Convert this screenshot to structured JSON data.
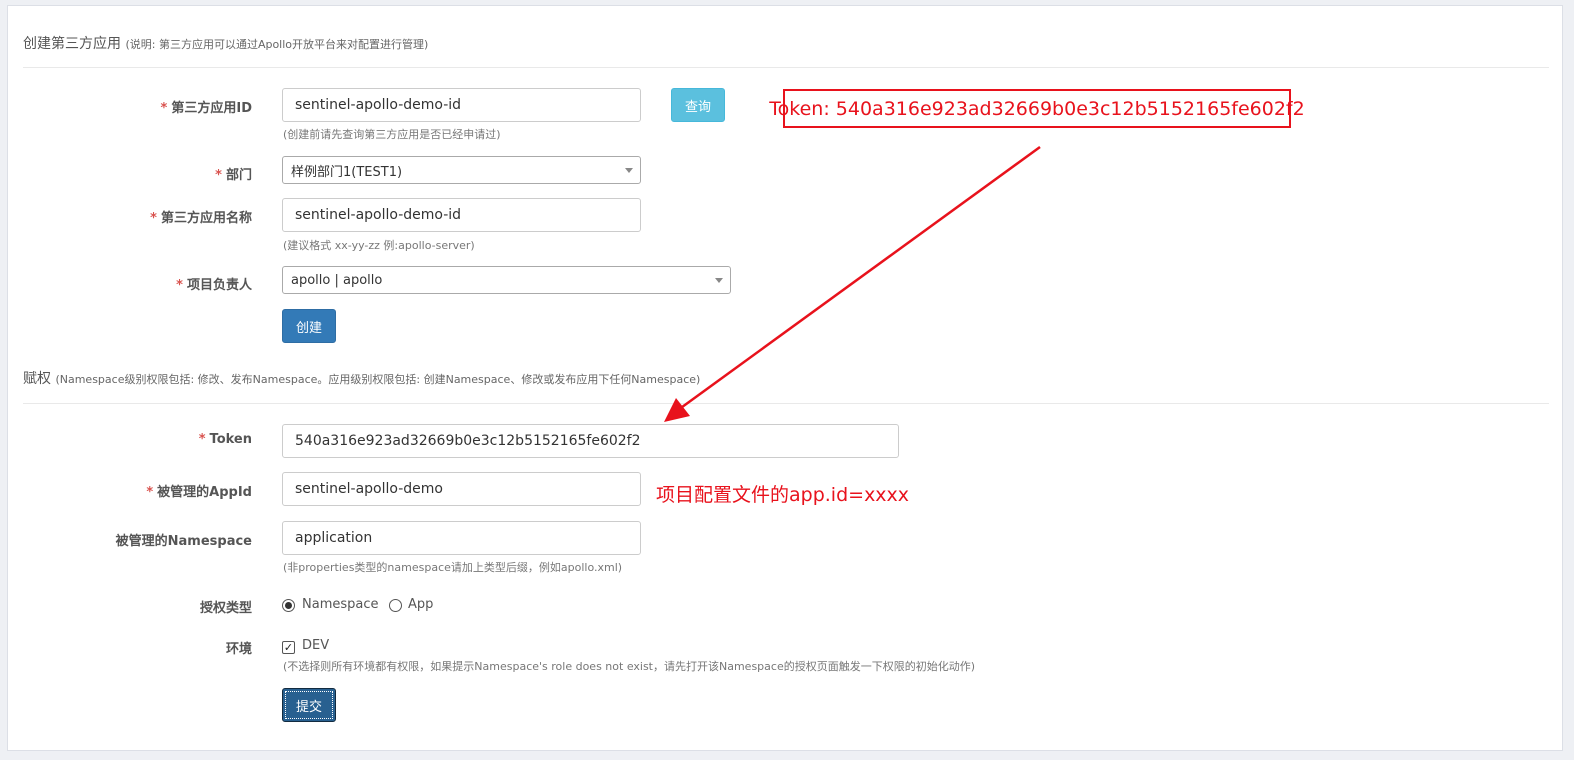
{
  "create_section": {
    "title": "创建第三方应用",
    "subtitle": "(说明: 第三方应用可以通过Apollo开放平台来对配置进行管理)",
    "app_id": {
      "required_mark": "*",
      "label": "第三方应用ID",
      "value": "sentinel-apollo-demo-id",
      "help": "(创建前请先查询第三方应用是否已经申请过)",
      "query_button": "查询"
    },
    "department": {
      "required_mark": "*",
      "label": "部门",
      "selected": "样例部门1(TEST1)"
    },
    "app_name": {
      "required_mark": "*",
      "label": "第三方应用名称",
      "value": "sentinel-apollo-demo-id",
      "help": "(建议格式 xx-yy-zz 例:apollo-server)"
    },
    "owner": {
      "required_mark": "*",
      "label": "项目负责人",
      "selected": "apollo | apollo"
    },
    "create_button": "创建"
  },
  "grant_section": {
    "title": "赋权",
    "subtitle": "(Namespace级别权限包括: 修改、发布Namespace。应用级别权限包括: 创建Namespace、修改或发布应用下任何Namespace)",
    "token": {
      "required_mark": "*",
      "label": "Token",
      "value": "540a316e923ad32669b0e3c12b5152165fe602f2"
    },
    "managed_app_id": {
      "required_mark": "*",
      "label": "被管理的AppId",
      "value": "sentinel-apollo-demo"
    },
    "managed_namespace": {
      "label": "被管理的Namespace",
      "value": "application",
      "help": "(非properties类型的namespace请加上类型后缀，例如apollo.xml)"
    },
    "grant_type": {
      "label": "授权类型",
      "options": [
        "Namespace",
        "App"
      ],
      "selected": "Namespace"
    },
    "env": {
      "label": "环境",
      "options": [
        "DEV"
      ],
      "checked": [
        "DEV"
      ],
      "help": "(不选择则所有环境都有权限，如果提示Namespace's role does not exist，请先打开该Namespace的授权页面触发一下权限的初始化动作)"
    },
    "submit_button": "提交"
  },
  "annotations": {
    "token_callout": "Token: 540a316e923ad32669b0e3c12b5152165fe602f2",
    "appid_note": "项目配置文件的app.id=xxxx",
    "color": "#e8121c"
  },
  "colors": {
    "info_button": "#5bc0de",
    "primary_button": "#337ab7",
    "required": "#d9534f"
  }
}
